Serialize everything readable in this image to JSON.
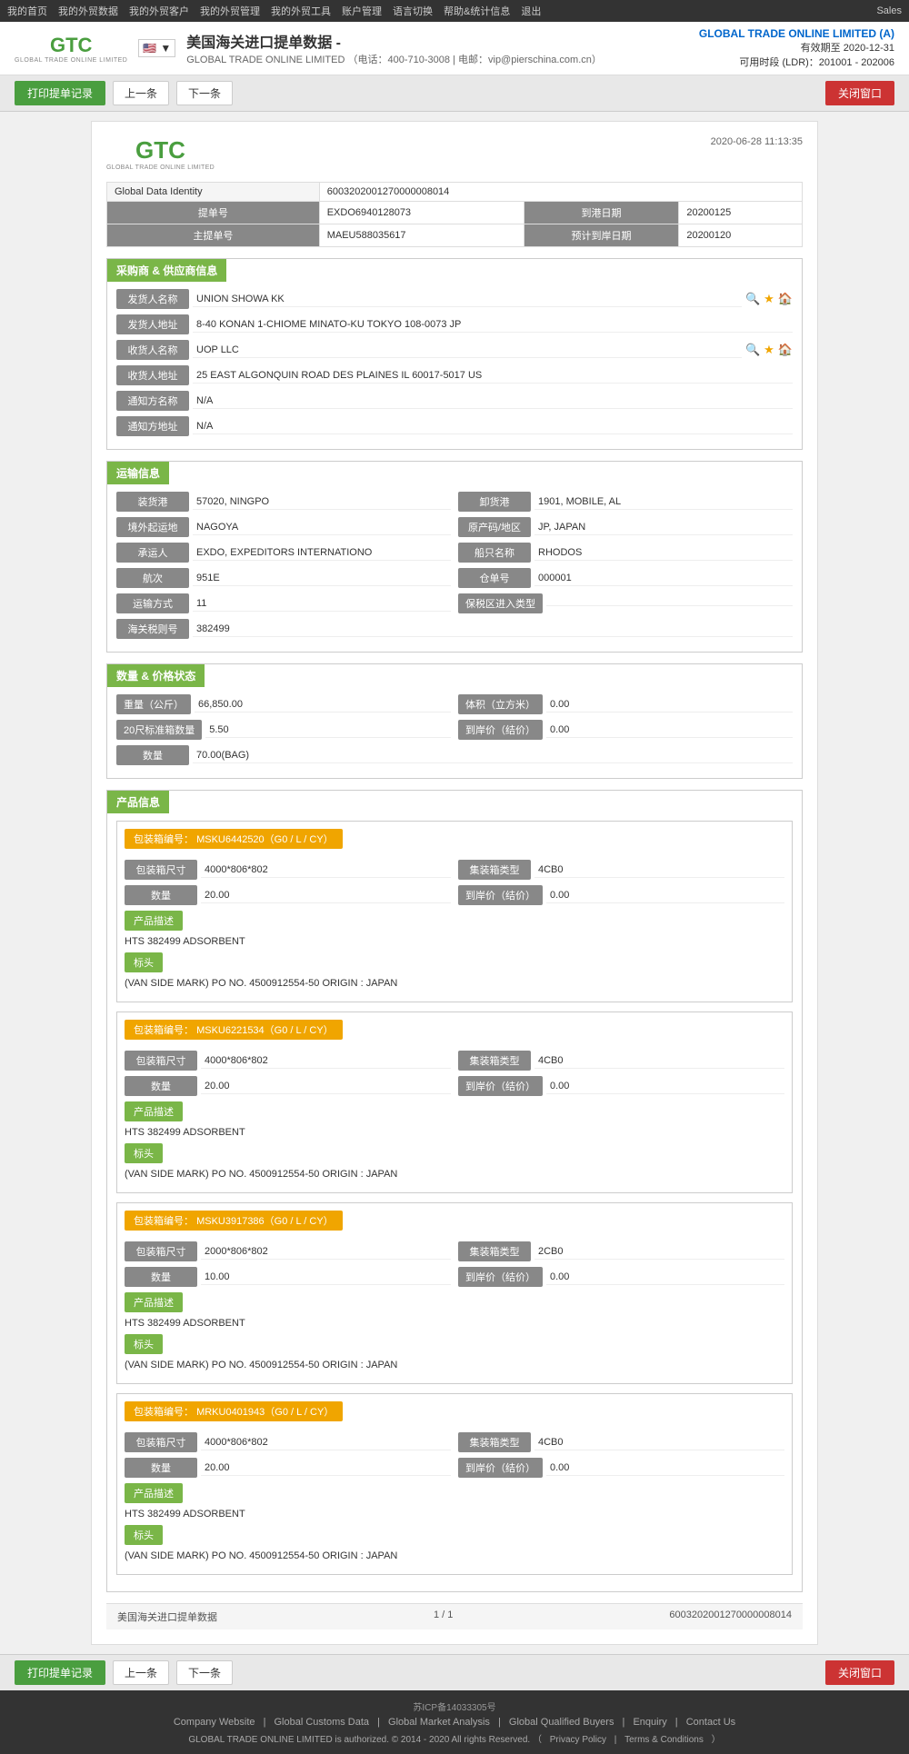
{
  "topNav": {
    "items": [
      "我的首页",
      "我的外贸数据",
      "我的外贸客户",
      "我的外贸管理",
      "我的外贸工具",
      "账户管理",
      "语言切换",
      "帮助&统计信息",
      "退出"
    ],
    "right": "Sales"
  },
  "header": {
    "pageTitle": "美国海关进口提单数据 -",
    "company": "GLOBAL TRADE ONLINE LIMITED",
    "phone": "400-710-3008",
    "email": "vip@pierschina.com.cn",
    "rightCompany": "GLOBAL TRADE ONLINE LIMITED (A)",
    "validity": "有效期至 2020-12-31",
    "timeInfo": "可用时段 (LDR)：201001 - 202006"
  },
  "toolbar": {
    "printLabel": "打印提单记录",
    "prevLabel": "上一条",
    "nextLabel": "下一条",
    "closeLabel": "关闭窗口"
  },
  "document": {
    "datetime": "2020-06-28 11:13:35",
    "globalDataIdentity": "6003202001270000008014",
    "fields": {
      "billNo": "EXDO6940128073",
      "arrivalDate": "20200125",
      "masterBillNo": "MAEU588035617",
      "estimatedArrivalDate": "20200120"
    },
    "labels": {
      "billNo": "提单号",
      "arrivalDate": "到港日期",
      "masterBillNo": "主提单号",
      "estimatedArrivalDate": "预计到岸日期",
      "globalDataIdentity": "Global Data Identity"
    }
  },
  "section1": {
    "title": "采购商 & 供应商信息",
    "fields": {
      "shipperName": "UNION SHOWA KK",
      "shipperAddress": "8-40 KONAN 1-CHIOME MINATO-KU TOKYO 108-0073 JP",
      "consigneeName": "UOP LLC",
      "consigneeAddress": "25 EAST ALGONQUIN ROAD DES PLAINES IL 60017-5017 US",
      "notifyName": "N/A",
      "notifyAddress": "N/A"
    },
    "labels": {
      "shipperName": "发货人名称",
      "shipperAddress": "发货人地址",
      "consigneeName": "收货人名称",
      "consigneeAddress": "收货人地址",
      "notifyName": "通知方名称",
      "notifyAddress": "通知方地址"
    }
  },
  "section2": {
    "title": "运输信息",
    "fields": {
      "loadPort": "57020, NINGPO",
      "unloadPort": "1901, MOBILE, AL",
      "origin": "NAGOYA",
      "originCountry": "JP, JAPAN",
      "carrier": "EXDO, EXPEDITORS INTERNATIONO",
      "vesselName": "RHODOS",
      "voyage": "951E",
      "billOfLading": "000001",
      "transportMode": "11",
      "customsBondType": "",
      "customsTax": "382499"
    },
    "labels": {
      "loadPort": "装货港",
      "unloadPort": "卸货港",
      "origin": "境外起运地",
      "originCountry": "原产码/地区",
      "carrier": "承运人",
      "vesselName": "船只名称",
      "voyage": "航次",
      "billOfLading": "仓单号",
      "transportMode": "运输方式",
      "customsBondType": "保税区进入类型",
      "customsTax": "海关税则号"
    }
  },
  "section3": {
    "title": "数量 & 价格状态",
    "fields": {
      "weight": "66,850.00",
      "volume": "0.00",
      "containers20": "5.50",
      "unitPrice": "0.00",
      "quantity": "70.00(BAG)"
    },
    "labels": {
      "weight": "重量（公斤）",
      "volume": "体积（立方米）",
      "containers20": "20尺标准箱数量",
      "unitPrice": "到岸价（结价）",
      "quantity": "数量"
    }
  },
  "section4": {
    "title": "产品信息",
    "products": [
      {
        "containerNo": "MSKU6442520（G0 / L / CY）",
        "containerSize": "4000*806*802",
        "containerType": "4CB0",
        "quantity": "20.00",
        "unitPrice": "0.00",
        "description": "HTS 382499 ADSORBENT",
        "marks": "(VAN SIDE MARK) PO NO. 4500912554-50 ORIGIN : JAPAN"
      },
      {
        "containerNo": "MSKU6221534（G0 / L / CY）",
        "containerSize": "4000*806*802",
        "containerType": "4CB0",
        "quantity": "20.00",
        "unitPrice": "0.00",
        "description": "HTS 382499 ADSORBENT",
        "marks": "(VAN SIDE MARK) PO NO. 4500912554-50 ORIGIN : JAPAN"
      },
      {
        "containerNo": "MSKU3917386（G0 / L / CY）",
        "containerSize": "2000*806*802",
        "containerType": "2CB0",
        "quantity": "10.00",
        "unitPrice": "0.00",
        "description": "HTS 382499 ADSORBENT",
        "marks": "(VAN SIDE MARK) PO NO. 4500912554-50 ORIGIN : JAPAN"
      },
      {
        "containerNo": "MRKU0401943（G0 / L / CY）",
        "containerSize": "4000*806*802",
        "containerType": "4CB0",
        "quantity": "20.00",
        "unitPrice": "0.00",
        "description": "HTS 382499 ADSORBENT",
        "marks": "(VAN SIDE MARK) PO NO. 4500912554-50 ORIGIN : JAPAN"
      }
    ],
    "labels": {
      "containerNo": "包装箱编号",
      "containerSize": "包装箱尺寸",
      "containerType": "集装箱类型",
      "quantity": "数量",
      "unitPrice": "到岸价（结价）",
      "description": "产品描述",
      "marks": "标头"
    }
  },
  "docFooter": {
    "label": "美国海关进口提单数据",
    "pagination": "1 / 1",
    "globalId": "6003202001270000008014"
  },
  "siteFooter": {
    "icp": "苏ICP备14033305号",
    "links": [
      "Company Website",
      "Global Customs Data",
      "Global Market Analysis",
      "Global Qualified Buyers",
      "Enquiry",
      "Contact Us"
    ],
    "copyright": "GLOBAL TRADE ONLINE LIMITED is authorized. © 2014 - 2020 All rights Reserved.",
    "privacy": "Privacy Policy",
    "terms": "Terms & Conditions"
  }
}
